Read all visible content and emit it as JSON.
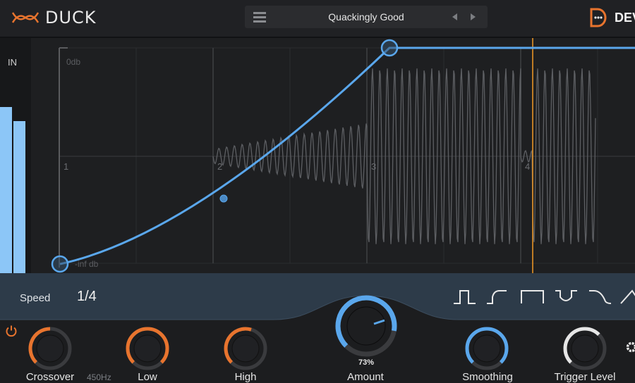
{
  "app": {
    "title": "DUCK",
    "brand": "DEV"
  },
  "preset": {
    "name": "Quackingly Good"
  },
  "meter": {
    "label": "IN"
  },
  "graph": {
    "top_label": "0db",
    "bottom_label": "-inf db",
    "beats": [
      "1",
      "2",
      "3",
      "4"
    ]
  },
  "speed": {
    "label": "Speed",
    "value": "1/4"
  },
  "shapes": [
    "square",
    "ramp-up",
    "hold",
    "dip",
    "ramp-down",
    "triangle"
  ],
  "knobs": {
    "crossover": {
      "label": "Crossover",
      "value_text": "450Hz"
    },
    "low": {
      "label": "Low"
    },
    "high": {
      "label": "High"
    },
    "amount": {
      "label": "Amount",
      "value_text": "73%"
    },
    "smoothing": {
      "label": "Smoothing"
    },
    "trigger": {
      "label": "Trigger Level"
    }
  },
  "colors": {
    "accent_blue": "#5aa7ec",
    "accent_orange": "#e8742e",
    "playhead": "#f39a26"
  }
}
